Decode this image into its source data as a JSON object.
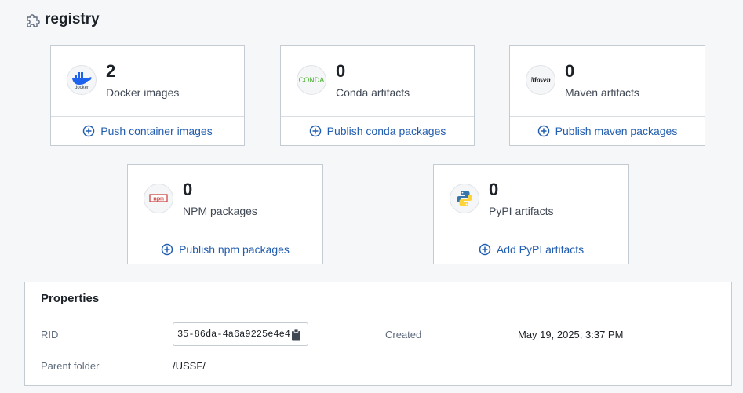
{
  "header": {
    "title": "registry",
    "icon": "puzzle-icon"
  },
  "cards": [
    {
      "count": "2",
      "label": "Docker images",
      "action": "Push container images",
      "icon": "docker-icon",
      "logo_text": "docker"
    },
    {
      "count": "0",
      "label": "Conda artifacts",
      "action": "Publish conda packages",
      "icon": "conda-icon",
      "logo_text": "CONDA"
    },
    {
      "count": "0",
      "label": "Maven artifacts",
      "action": "Publish maven packages",
      "icon": "maven-icon",
      "logo_text": "Maven"
    },
    {
      "count": "0",
      "label": "NPM packages",
      "action": "Publish npm packages",
      "icon": "npm-icon",
      "logo_text": "npm"
    },
    {
      "count": "0",
      "label": "PyPI artifacts",
      "action": "Add PyPI artifacts",
      "icon": "python-icon"
    }
  ],
  "properties": {
    "title": "Properties",
    "rid_label": "RID",
    "rid_value": "35-86da-4a6a9225e4e4",
    "created_label": "Created",
    "created_value": "May 19, 2025, 3:37 PM",
    "parent_label": "Parent folder",
    "parent_value": "/USSF/"
  },
  "colors": {
    "accent": "#215db0",
    "border": "#c5cbd3",
    "text": "#1c2127",
    "muted": "#5f6b7c"
  }
}
